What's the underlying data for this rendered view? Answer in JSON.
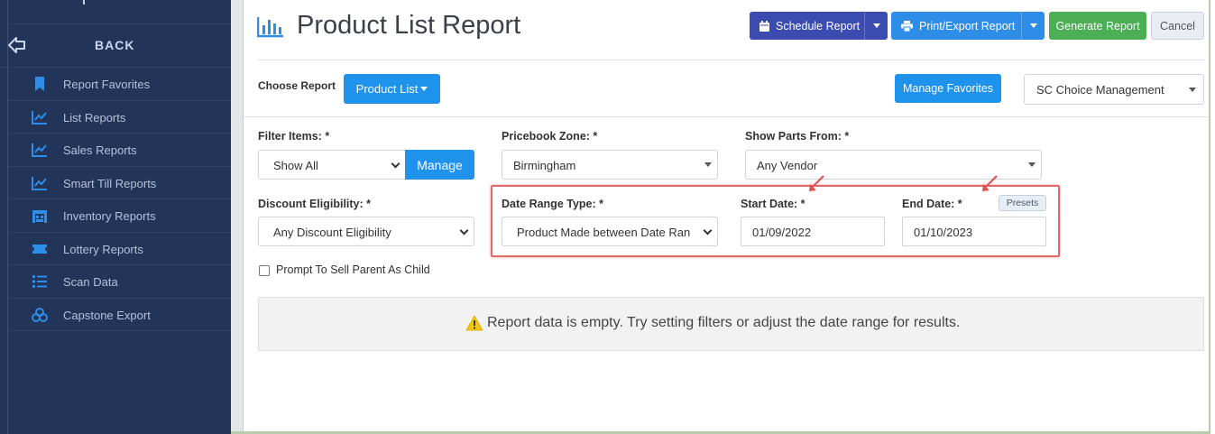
{
  "sidebar": {
    "back_label": "BACK",
    "items": [
      {
        "label": "Report Favorites",
        "icon": "bookmark-icon"
      },
      {
        "label": "List Reports",
        "icon": "line-chart-icon"
      },
      {
        "label": "Sales Reports",
        "icon": "line-chart-icon"
      },
      {
        "label": "Smart Till Reports",
        "icon": "line-chart-icon"
      },
      {
        "label": "Inventory Reports",
        "icon": "warehouse-icon"
      },
      {
        "label": "Lottery Reports",
        "icon": "ticket-icon"
      },
      {
        "label": "Scan Data",
        "icon": "list-icon"
      },
      {
        "label": "Capstone Export",
        "icon": "cubes-icon"
      }
    ]
  },
  "header": {
    "title": "Product List Report",
    "schedule_label": "Schedule Report",
    "print_label": "Print/Export Report",
    "generate_label": "Generate Report",
    "cancel_label": "Cancel"
  },
  "choose": {
    "label": "Choose Report",
    "report_button": "Product List",
    "favorites_button": "Manage Favorites",
    "company": "SC Choice Management"
  },
  "filters": {
    "filter_items_label": "Filter Items: *",
    "filter_items_value": "Show All",
    "manage_label": "Manage",
    "pricebook_label": "Pricebook Zone: *",
    "pricebook_value": "Birmingham",
    "parts_label": "Show Parts From: *",
    "parts_value": "Any Vendor",
    "discount_label": "Discount Eligibility: *",
    "discount_value": "Any Discount Eligibility",
    "date_range_label": "Date Range Type: *",
    "date_range_value": "Product Made between Date Range",
    "start_label": "Start Date: *",
    "start_value": "01/09/2022",
    "end_label": "End Date: *",
    "end_value": "01/10/2023",
    "presets_label": "Presets",
    "prompt_label": "Prompt To Sell Parent As Child",
    "prompt_checked": false
  },
  "empty_message": "Report data is empty. Try setting filters or adjust the date range for results.",
  "colors": {
    "sidebar_bg": "#223458",
    "primary": "#1f92ec",
    "schedule": "#3c4bb0",
    "generate": "#4cae55",
    "highlight": "#e46a6a",
    "warning": "#f3c614"
  }
}
